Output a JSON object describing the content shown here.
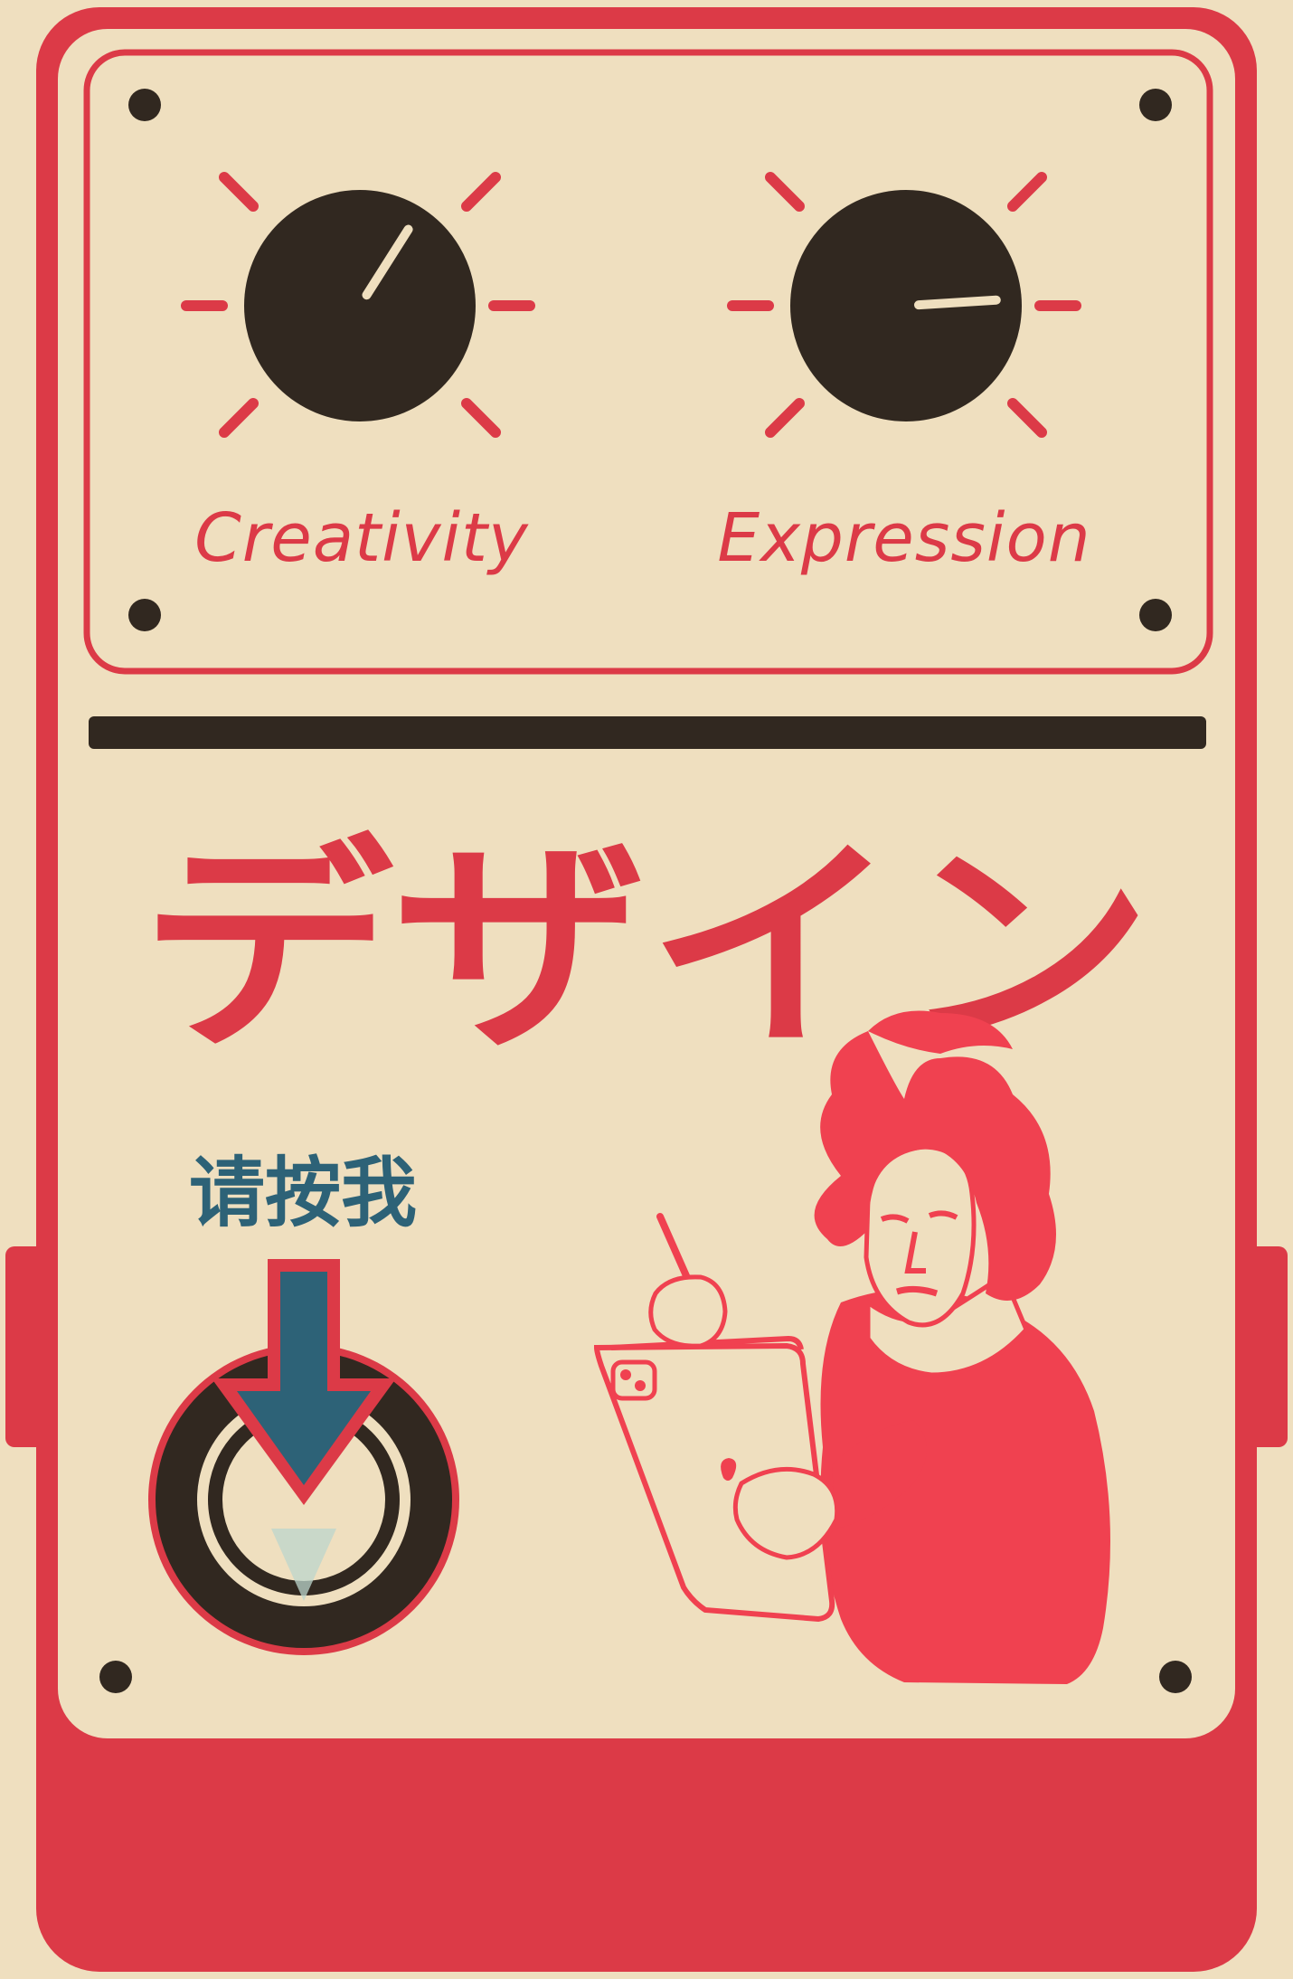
{
  "knobs": [
    {
      "label": "Creativity",
      "level": 0.62
    },
    {
      "label": "Expression",
      "level": 0.82
    }
  ],
  "title": "デザイン",
  "press_label": "请按我",
  "icons": {
    "screw": "screw-icon",
    "footswitch": "footswitch-power-icon",
    "arrow": "arrow-down-icon",
    "illustration": "composer-with-tablet-illustration"
  },
  "colors": {
    "background": "#efdfbf",
    "pedal_red": "#dc3a47",
    "panel_cream": "#efdfbf",
    "knob_dark": "#312820",
    "arrow_teal": "#2d6277",
    "illustration_red": "#f04150"
  }
}
